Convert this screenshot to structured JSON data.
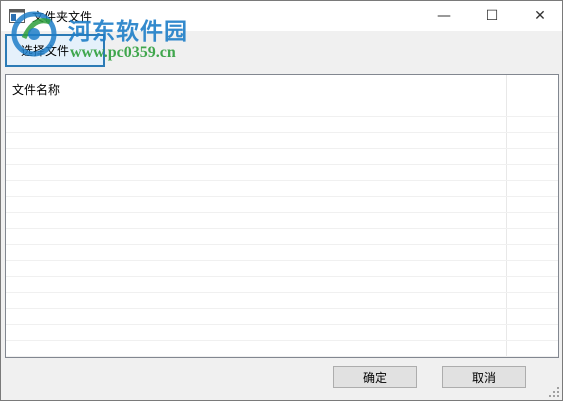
{
  "window": {
    "title": "文件夹文件",
    "controls": {
      "minimize": "—",
      "maximize": "☐",
      "close": "✕"
    }
  },
  "watermark": {
    "site_name": "河东软件园",
    "url": "www.pc0359.cn"
  },
  "toolbar": {
    "select_files_label": "选择文件"
  },
  "file_list": {
    "columns": [
      "文件名称"
    ],
    "rows": []
  },
  "dialog_buttons": {
    "ok_label": "确定",
    "cancel_label": "取消"
  }
}
